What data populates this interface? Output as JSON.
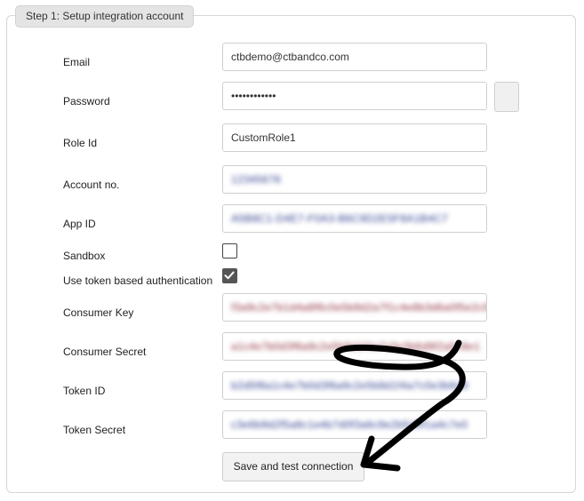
{
  "section": {
    "legend": "Step 1: Setup integration account"
  },
  "fields": {
    "email": {
      "label": "Email",
      "value": "ctbdemo@ctbandco.com"
    },
    "password": {
      "label": "Password",
      "value": "••••••••••••"
    },
    "role_id": {
      "label": "Role Id",
      "value": "CustomRole1"
    },
    "account_no": {
      "label": "Account no.",
      "value": "12345678"
    },
    "app_id": {
      "label": "App ID",
      "value": "A5B8C1-D4E7-F0A3-B6C9D2E5F8A1B4C7"
    },
    "sandbox": {
      "label": "Sandbox",
      "checked": false
    },
    "token_auth": {
      "label": "Use token based authentication",
      "checked": true
    },
    "consumer_key": {
      "label": "Consumer Key",
      "value": "f3a9c2e7b1d4a8f6c0e5b9d2a7f1c4e8b3d6a0f5e2c9"
    },
    "consumer_secret": {
      "label": "Consumer Secret",
      "value": "a1c4e7b0d3f6a9c2e5b8d1f4a7c0e3b6d9f2a5c8e1"
    },
    "token_id": {
      "label": "Token ID",
      "value": "b2d5f8a1c4e7b0d3f6a9c2e5b8d1f4a7c0e3b6d9"
    },
    "token_secret": {
      "label": "Token Secret",
      "value": "c3e6b9d2f5a8c1e4b7d0f3a6c9e2b5d8f1a4c7e0"
    }
  },
  "actions": {
    "save_label": "Save and test connection"
  },
  "icons": {
    "eye_button": "show-password-icon",
    "annotation": "curved-arrow-icon"
  },
  "colors": {
    "legend_bg": "#e4e4e4",
    "border": "#cfcfcf",
    "annotation": "#000000"
  }
}
